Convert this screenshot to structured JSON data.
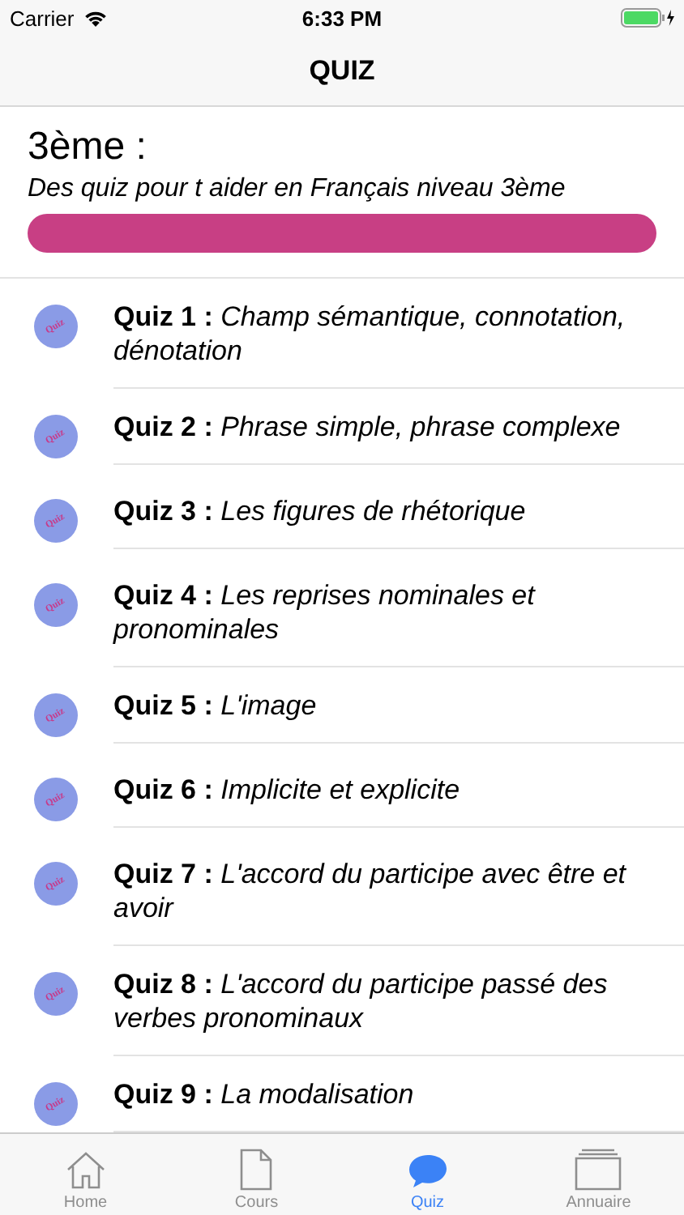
{
  "status_bar": {
    "carrier": "Carrier",
    "time": "6:33 PM"
  },
  "nav": {
    "title": "QUIZ"
  },
  "header": {
    "title": "3ème :",
    "subtitle": "Des quiz pour t aider en Français niveau 3ème"
  },
  "quizzes": [
    {
      "badge": "Quiz",
      "label": "Quiz 1 :",
      "title": "Champ sémantique, connotation, dénotation"
    },
    {
      "badge": "Quiz",
      "label": "Quiz 2 :",
      "title": "Phrase simple, phrase complexe"
    },
    {
      "badge": "Quiz",
      "label": "Quiz 3 :",
      "title": "Les figures de rhétorique"
    },
    {
      "badge": "Quiz",
      "label": "Quiz 4 :",
      "title": "Les reprises nominales et pronominales"
    },
    {
      "badge": "Quiz",
      "label": "Quiz 5 :",
      "title": "L'image"
    },
    {
      "badge": "Quiz",
      "label": "Quiz 6 :",
      "title": "Implicite et explicite"
    },
    {
      "badge": "Quiz",
      "label": "Quiz 7 :",
      "title": "L'accord du participe avec être et avoir"
    },
    {
      "badge": "Quiz",
      "label": "Quiz 8 :",
      "title": "L'accord du participe passé des verbes pronominaux"
    },
    {
      "badge": "Quiz",
      "label": "Quiz 9 :",
      "title": "La modalisation"
    }
  ],
  "tabs": [
    {
      "kind": "home",
      "label": "Home",
      "selected": false
    },
    {
      "kind": "document",
      "label": "Cours",
      "selected": false
    },
    {
      "kind": "chat",
      "label": "Quiz",
      "selected": true
    },
    {
      "kind": "folder",
      "label": "Annuaire",
      "selected": false
    }
  ]
}
